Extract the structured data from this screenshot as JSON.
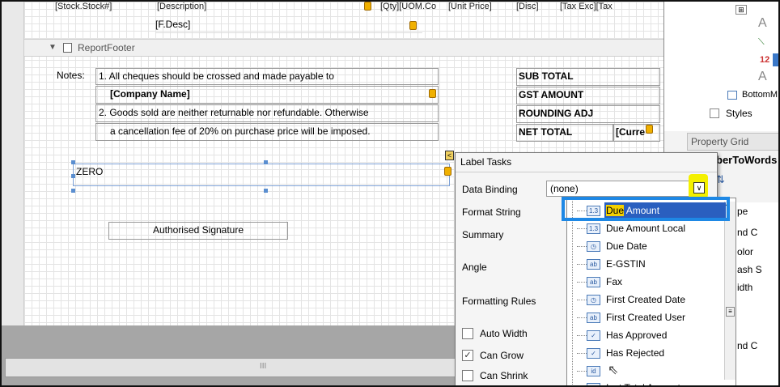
{
  "designer": {
    "header_row": {
      "stock": "[Stock.Stock#]",
      "description": "[Description]",
      "qty": "[Qty][UOM.Co",
      "unit_price": "[Unit Price]",
      "disc": "[Disc]",
      "tax": "[Tax Exc][Tax"
    },
    "f_desc": "[F.Desc]",
    "footer_band": "ReportFooter",
    "notes_label": "Notes:",
    "note1": "1.  All cheques should be crossed and made payable to",
    "company_name": "[Company Name]",
    "note2": "2.  Goods sold are neither returnable nor refundable. Otherwise",
    "note2b": "a cancellation fee of 20% on purchase price will be imposed.",
    "totals": [
      "SUB TOTAL",
      "GST AMOUNT",
      "ROUNDING ADJ",
      "NET TOTAL"
    ],
    "currency": "[Curre",
    "zero_label": "ZERO",
    "signature": "Authorised Signature",
    "hscroll_mark": "III"
  },
  "right_panel": {
    "tree_item_a1": "A",
    "tree_item_12": "12",
    "tree_item_a2": "A",
    "bottom_item": "BottomM",
    "styles": "Styles",
    "property_grid": "Property Grid",
    "selected_object": "berToWords",
    "props": [
      "pe",
      "nd C",
      "olor",
      "ash S",
      "idth",
      "nd C"
    ]
  },
  "tasks": {
    "title": "Label Tasks",
    "data_binding_label": "Data Binding",
    "data_binding_value": "(none)",
    "format_string": "Format String",
    "summary": "Summary",
    "angle": "Angle",
    "formatting_rules": "Formatting Rules",
    "auto_width": "Auto Width",
    "can_grow": "Can Grow",
    "can_shrink": "Can Shrink"
  },
  "dropdown": {
    "items": [
      {
        "icon": "1.3",
        "label": "Due Amount",
        "selected": true
      },
      {
        "icon": "1.3",
        "label": "Due Amount Local"
      },
      {
        "icon": "clock",
        "label": "Due Date"
      },
      {
        "icon": "ab",
        "label": "E-GSTIN"
      },
      {
        "icon": "ab",
        "label": "Fax"
      },
      {
        "icon": "clock",
        "label": "First Created Date"
      },
      {
        "icon": "ab",
        "label": "First Created User"
      },
      {
        "icon": "check",
        "label": "Has Approved"
      },
      {
        "icon": "check",
        "label": "Has Rejected"
      },
      {
        "icon": "id",
        "label": ""
      },
      {
        "icon": "1.3",
        "label": "Igst Total Amount"
      }
    ],
    "highlight_prefix": "Due",
    "highlight_rest": " Amount"
  }
}
